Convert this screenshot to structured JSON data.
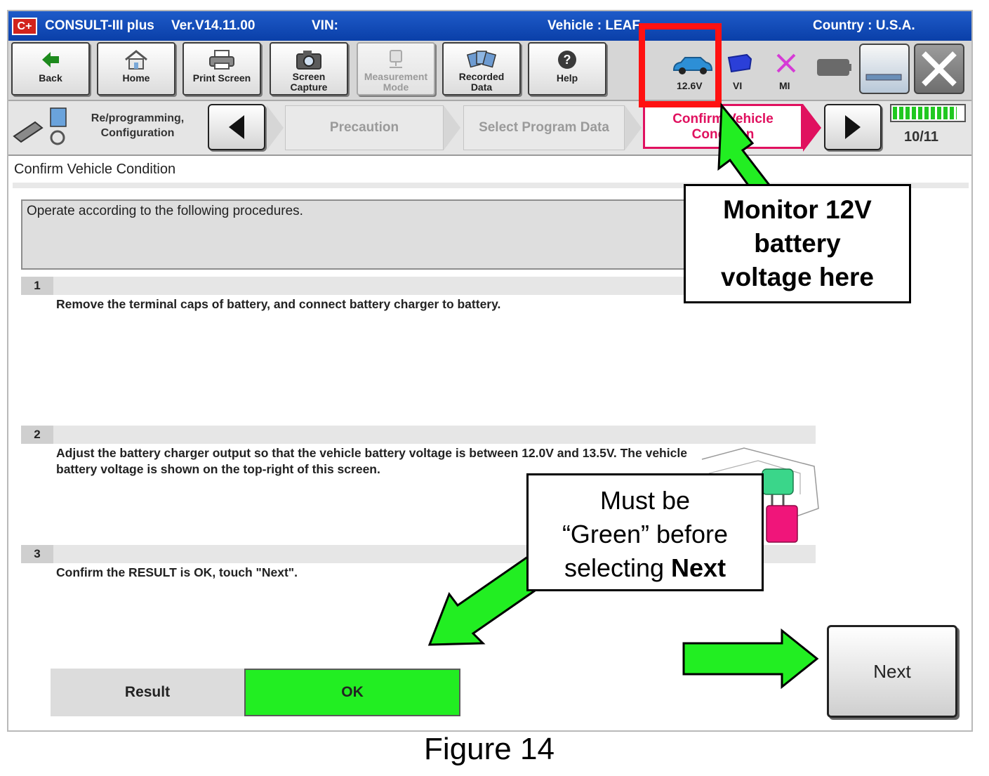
{
  "titlebar": {
    "logo": "C+",
    "app": "CONSULT-III plus",
    "version": "Ver.V14.11.00",
    "vin_label": "VIN:",
    "vehicle": "Vehicle : LEAF",
    "country": "Country : U.S.A."
  },
  "toolbar": {
    "back": "Back",
    "home": "Home",
    "print_screen": "Print Screen",
    "screen_capture_1": "Screen",
    "screen_capture_2": "Capture",
    "measurement_1": "Measurement",
    "measurement_2": "Mode",
    "recorded_1": "Recorded",
    "recorded_2": "Data",
    "help": "Help"
  },
  "status": {
    "battery_voltage": "12.6V",
    "vi": "VI",
    "mi": "MI"
  },
  "stepbar": {
    "mode_1": "Re/programming,",
    "mode_2": "Configuration",
    "step_precaution": "Precaution",
    "step_select": "Select Program Data",
    "step_current_1": "Confirm Vehicle",
    "step_current_2": "Condition",
    "progress": "10/11",
    "progress_fraction": 0.909
  },
  "main": {
    "page_title": "Confirm Vehicle Condition",
    "instruction": "Operate according to the following procedures.",
    "steps": [
      {
        "num": "1",
        "text": "Remove the terminal caps of battery, and connect battery charger to battery."
      },
      {
        "num": "2",
        "text": "Adjust the battery charger output so that the vehicle battery voltage is between 12.0V and 13.5V. The vehicle battery voltage is shown on the top-right of this screen."
      },
      {
        "num": "3",
        "text": "Confirm the RESULT is OK, touch \"Next\"."
      }
    ],
    "result_label": "Result",
    "result_value": "OK",
    "next": "Next"
  },
  "annotations": {
    "monitor_1": "Monitor 12V",
    "monitor_2": "battery",
    "monitor_3": "voltage here",
    "green_1": "Must be",
    "green_2": "“Green” before",
    "green_3": "selecting ",
    "green_bold": "Next",
    "caption": "Figure 14"
  },
  "colors": {
    "titlebar": "#0a3fa8",
    "ok_green": "#22ee22",
    "current_step": "#e0115f",
    "highlight_red": "#ff1111",
    "arrow_green": "#22ee22"
  }
}
